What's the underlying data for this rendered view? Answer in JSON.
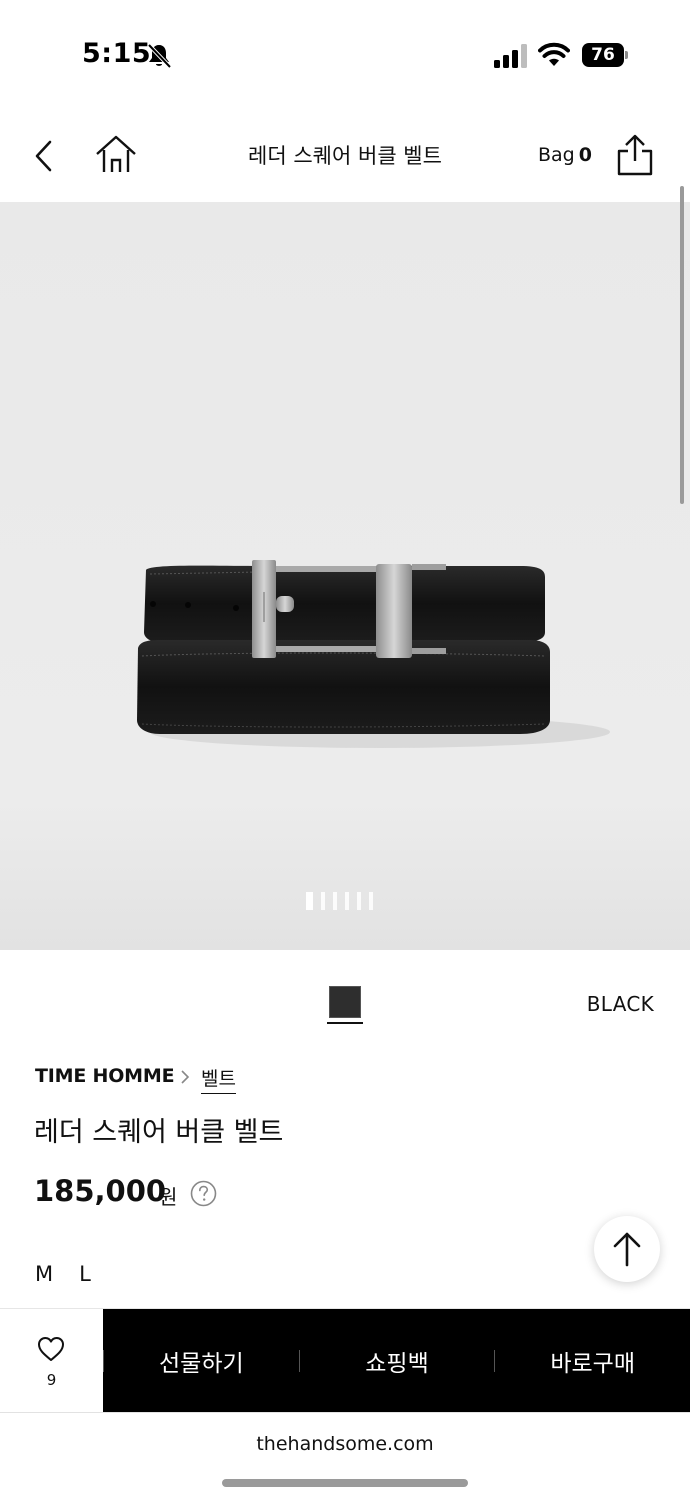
{
  "status_bar": {
    "time": "5:15",
    "battery": "76"
  },
  "header": {
    "title": "레더 스퀘어 버클 벨트",
    "bag_label": "Bag",
    "bag_count": "0"
  },
  "gallery": {
    "image_count": 6,
    "active_index": 0
  },
  "color": {
    "name": "BLACK",
    "swatch_color": "#2e2e2e"
  },
  "product": {
    "brand": "TIME HOMME",
    "category": "벨트",
    "name": "레더 스퀘어 버클 벨트",
    "price": "185,000",
    "currency": "원"
  },
  "sizes": [
    "M",
    "L"
  ],
  "action_bar": {
    "wish_count": "9",
    "gift_label": "선물하기",
    "bag_label": "쇼핑백",
    "buy_label": "바로구매"
  },
  "browser": {
    "url": "thehandsome.com"
  },
  "icons": {
    "back": "back-chevron-icon",
    "home": "home-icon",
    "share": "share-icon",
    "help": "help-circle-icon",
    "top": "arrow-up-icon",
    "wish": "heart-icon"
  }
}
